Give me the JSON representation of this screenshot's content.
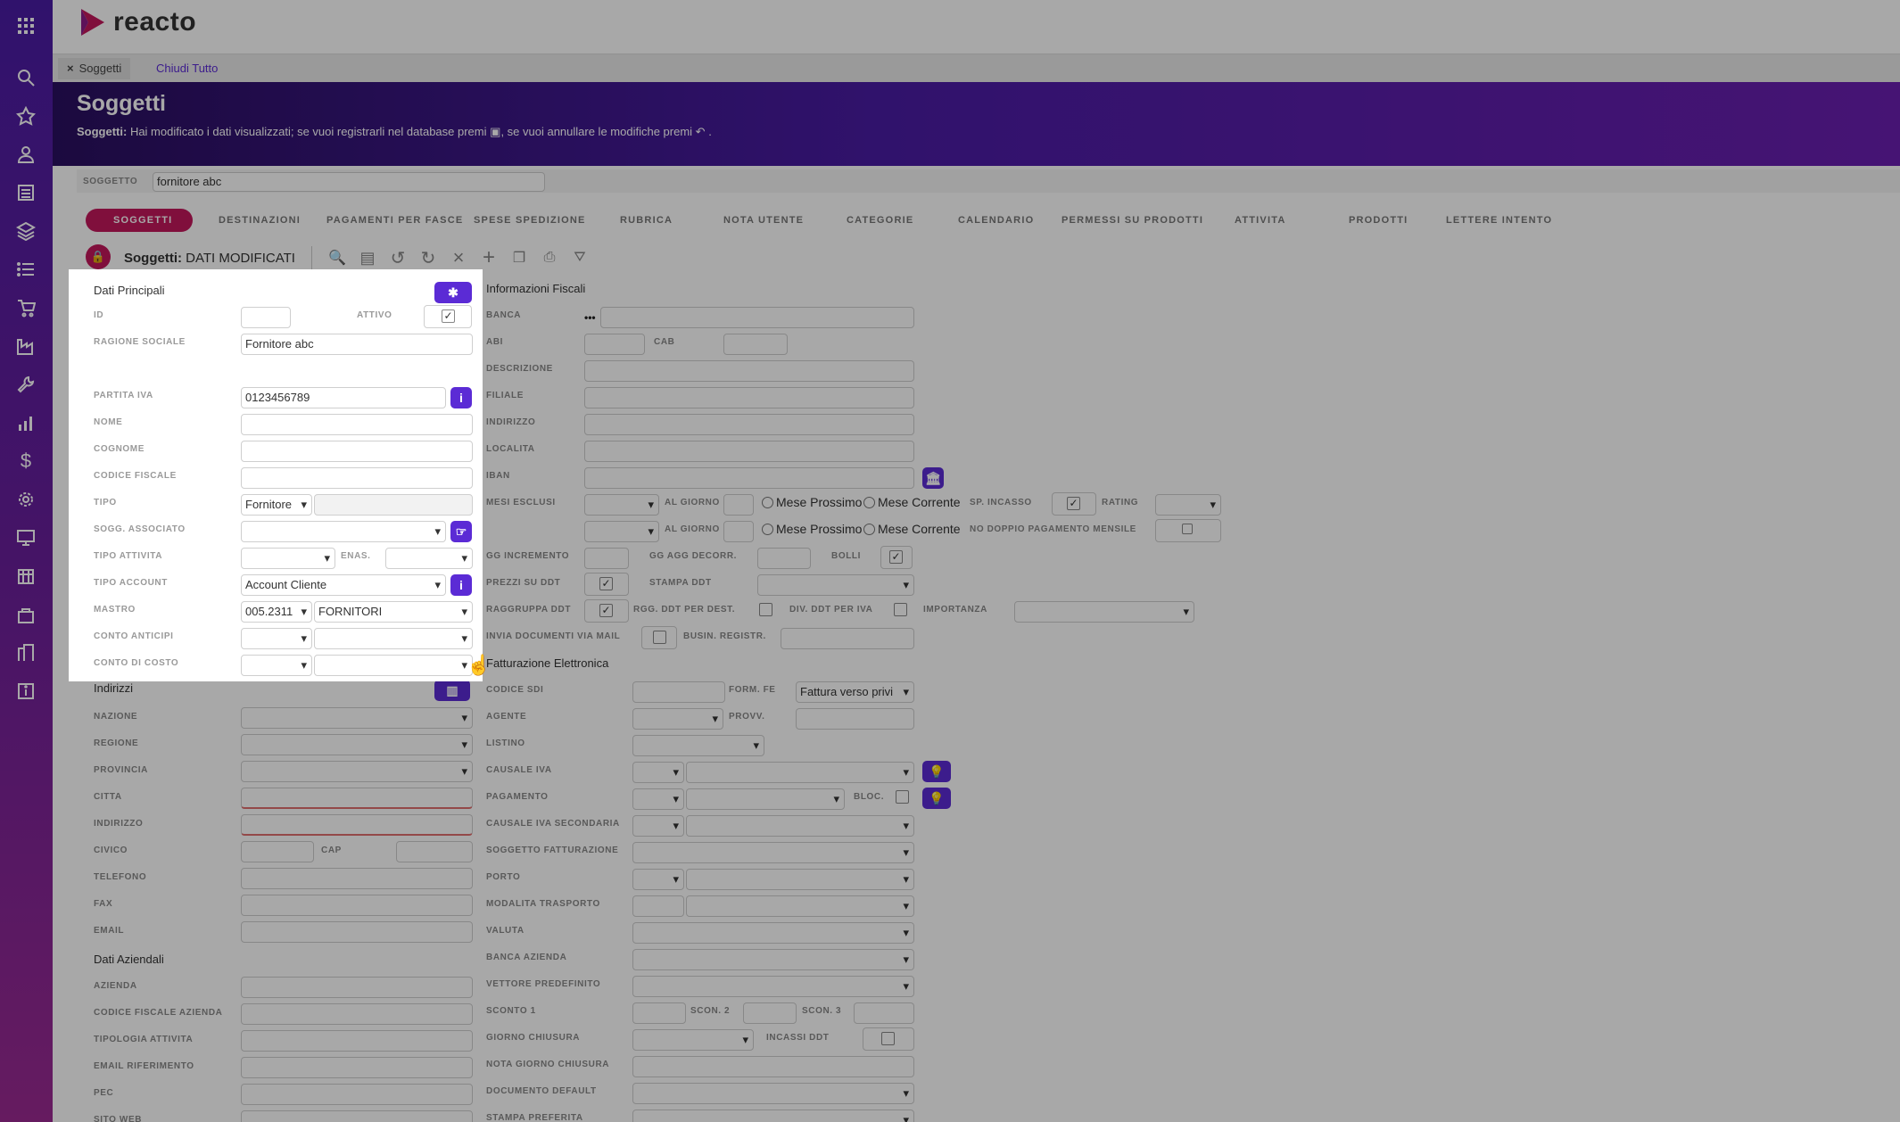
{
  "app": {
    "name": "reacto"
  },
  "sidebar": {
    "icons": [
      "grid-icon",
      "search-icon",
      "star-icon",
      "user-icon",
      "list-icon",
      "box-icon",
      "list-icon",
      "cart-icon",
      "factory-icon",
      "wrench-icon",
      "chart-icon",
      "dollar-icon",
      "gear-icon",
      "monitor-icon",
      "store-icon",
      "bag-icon",
      "building-icon",
      "info-icon"
    ]
  },
  "tabs": {
    "soggetti": "Soggetti",
    "close_all": "Chiudi Tutto"
  },
  "header": {
    "title": "Soggetti",
    "msg_bold": "Soggetti:",
    "msg_1": " Hai modificato i dati visualizzati; se vuoi registrarli nel database premi",
    "msg_2": ", se vuoi annullare le modifiche premi",
    "msg_3": "."
  },
  "search": {
    "label": "SOGGETTO",
    "value": "fornitore abc"
  },
  "nav": [
    "SOGGETTI",
    "DESTINAZIONI",
    "PAGAMENTI PER FASCE",
    "SPESE SPEDIZIONE",
    "RUBRICA",
    "NOTA UTENTE",
    "CATEGORIE",
    "CALENDARIO",
    "PERMESSI SU PRODOTTI",
    "ATTIVITA",
    "PRODOTTI",
    "LETTERE INTENTO"
  ],
  "toolbar": {
    "title": "Soggetti:",
    "status": "DATI MODIFICATI"
  },
  "dati_principali": {
    "title": "Dati Principali",
    "id_label": "ID",
    "attivo_label": "ATTIVO",
    "ragione_label": "RAGIONE SOCIALE",
    "ragione_value": "Fornitore abc",
    "piva_label": "PARTITA IVA",
    "piva_value": "0123456789",
    "nome_label": "NOME",
    "cognome_label": "COGNOME",
    "cf_label": "CODICE FISCALE",
    "tipo_label": "TIPO",
    "tipo_value": "Fornitore",
    "sogg_assoc_label": "SOGG. ASSOCIATO",
    "tipo_attivita_label": "TIPO ATTIVITA",
    "enas_label": "ENAS.",
    "tipo_account_label": "TIPO ACCOUNT",
    "tipo_account_value": "Account Cliente",
    "mastro_label": "MASTRO",
    "mastro_code": "005.2311",
    "mastro_value": "FORNITORI",
    "conto_anticipi_label": "CONTO ANTICIPI",
    "conto_costo_label": "CONTO DI COSTO"
  },
  "indirizzi": {
    "title": "Indirizzi",
    "labels": [
      "NAZIONE",
      "REGIONE",
      "PROVINCIA",
      "CITTA",
      "INDIRIZZO",
      "CIVICO",
      "TELEFONO",
      "FAX",
      "EMAIL"
    ],
    "cap_label": "CAP"
  },
  "dati_aziendali": {
    "title": "Dati Aziendali",
    "labels": [
      "AZIENDA",
      "CODICE FISCALE AZIENDA",
      "TIPOLOGIA ATTIVITA",
      "EMAIL RIFERIMENTO",
      "PEC",
      "SITO WEB"
    ]
  },
  "info_fiscali": {
    "title": "Informazioni Fiscali",
    "banca": "BANCA",
    "abi": "ABI",
    "cab": "CAB",
    "descrizione": "DESCRIZIONE",
    "filiale": "FILIALE",
    "indirizzo": "INDIRIZZO",
    "localita": "LOCALITA",
    "iban": "IBAN",
    "mesi_esclusi": "MESI ESCLUSI",
    "al_giorno": "AL GIORNO",
    "mese_prossimo": "Mese Prossimo",
    "mese_corrente": "Mese Corrente",
    "sp_incasso": "SP. INCASSO",
    "rating": "RATING",
    "no_doppio": "NO DOPPIO PAGAMENTO MENSILE",
    "gg_incremento": "GG INCREMENTO",
    "gg_agg": "GG AGG DECORR.",
    "bolli": "BOLLI",
    "prezzi_ddt": "PREZZI SU DDT",
    "stampa_ddt": "STAMPA DDT",
    "raggruppa": "RAGGRUPPA DDT",
    "rgg_dest": "RGG. DDT PER DEST.",
    "div_iva": "DIV. DDT PER IVA",
    "importanza": "IMPORTANZA",
    "invia_doc": "INVIA DOCUMENTI VIA MAIL",
    "busin": "BUSIN. REGISTR."
  },
  "fatturazione": {
    "title": "Fatturazione Elettronica",
    "codice_sdi": "CODICE SDI",
    "form_fe": "FORM. FE",
    "form_fe_value": "Fattura verso privi",
    "agente": "AGENTE",
    "provv": "PROVV.",
    "listino": "LISTINO",
    "causale_iva": "CAUSALE IVA",
    "pagamento": "PAGAMENTO",
    "bloc": "BLOC.",
    "causale_iva_sec": "CAUSALE IVA SECONDARIA",
    "sogg_fatt": "SOGGETTO FATTURAZIONE",
    "porto": "PORTO",
    "modalita": "MODALITA TRASPORTO",
    "valuta": "VALUTA",
    "banca_az": "BANCA AZIENDA",
    "vettore": "VETTORE PREDEFINITO",
    "sconto1": "SCONTO 1",
    "scon2": "SCON. 2",
    "scon3": "SCON. 3",
    "giorno_chiusura": "GIORNO CHIUSURA",
    "incassi": "INCASSI DDT",
    "nota_giorno": "NOTA GIORNO CHIUSURA",
    "doc_default": "DOCUMENTO DEFAULT",
    "stampa_pref": "STAMPA PREFERITA"
  },
  "colors": {
    "accent": "#5b2bd5",
    "header": "#4a1ca5",
    "active_tab": "#c2185b"
  }
}
